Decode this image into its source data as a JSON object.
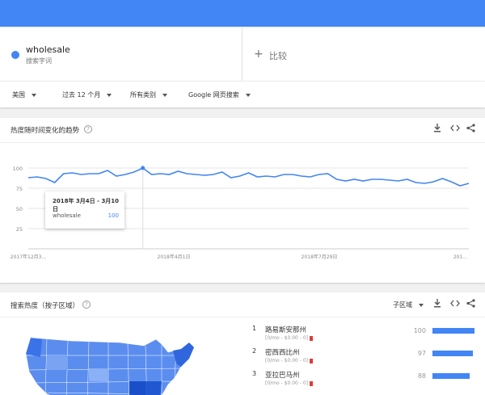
{
  "term": {
    "name": "wholesale",
    "type": "搜索字词",
    "color": "#4285f4"
  },
  "compare": {
    "plus": "+",
    "label": "比较"
  },
  "filters": [
    {
      "label": "美国"
    },
    {
      "label": "过去 12 个月"
    },
    {
      "label": "所有类别"
    },
    {
      "label": "Google 网页搜索"
    }
  ],
  "trend_card": {
    "title": "热度随时间变化的趋势",
    "help": "?",
    "tools": [
      "download-icon",
      "embed-icon",
      "share-icon"
    ]
  },
  "tooltip": {
    "date": "2018年 3月4日 - 3月10日",
    "term": "wholesale",
    "value": "100"
  },
  "chart_data": {
    "type": "line",
    "y_ticks": [
      "100",
      "75",
      "50",
      "25"
    ],
    "x_labels": [
      "2017年12月3...",
      "2018年4月1日",
      "2018年7月29日",
      "201..."
    ],
    "ylim": [
      0,
      100
    ],
    "grid": true,
    "series": [
      {
        "color": "#4285f4",
        "values": [
          88,
          89,
          87,
          82,
          93,
          94,
          92,
          93,
          93,
          97,
          90,
          92,
          95,
          100,
          92,
          93,
          92,
          96,
          93,
          92,
          91,
          92,
          95,
          88,
          90,
          94,
          89,
          90,
          89,
          92,
          92,
          90,
          89,
          92,
          93,
          86,
          84,
          86,
          84,
          86,
          86,
          85,
          84,
          86,
          82,
          81,
          83,
          87,
          83,
          78,
          81
        ]
      }
    ]
  },
  "region_card": {
    "title": "搜索热度（按子区域）",
    "help": "?",
    "dropdown": "子区域",
    "tools": [
      "download-icon",
      "embed-icon",
      "share-icon"
    ]
  },
  "rankings": [
    {
      "rank": "1",
      "name": "路易斯安那州",
      "sub": "[0/mo - $0.00 - 0]",
      "value": "100",
      "fraction": 1.0
    },
    {
      "rank": "2",
      "name": "密西西比州",
      "sub": "[0/mo - $0.00 - 0]",
      "value": "97",
      "fraction": 0.97
    },
    {
      "rank": "3",
      "name": "亚拉巴马州",
      "sub": "[0/mo - $0.00 - 0]",
      "value": "88",
      "fraction": 0.88
    }
  ]
}
